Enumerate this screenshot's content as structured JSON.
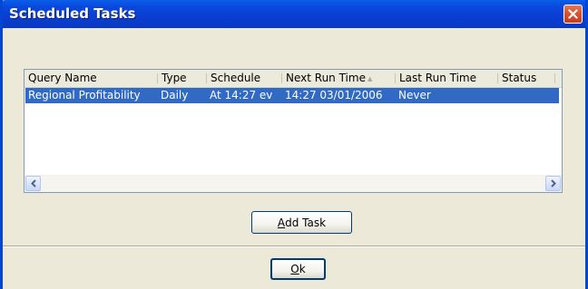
{
  "window": {
    "title": "Scheduled Tasks"
  },
  "table": {
    "columns": [
      "Query Name",
      "Type",
      "Schedule",
      "Next Run Time",
      "Last Run Time",
      "Status"
    ],
    "sorted_column": "Next Run Time",
    "rows": [
      {
        "query_name": "Regional Profitability",
        "type": "Daily",
        "schedule": "At 14:27 ev",
        "next_run_time": "14:27 03/01/2006",
        "last_run_time": "Never",
        "status": ""
      }
    ],
    "selected_row_color": "#316ac5"
  },
  "buttons": {
    "add_task": {
      "mnemonic": "A",
      "rest": "dd Task"
    },
    "ok": {
      "mnemonic": "O",
      "rest": "k"
    }
  },
  "icons": {
    "close": "close-icon",
    "scroll_up": "chevron-up-icon",
    "scroll_down": "chevron-down-icon",
    "scroll_left": "chevron-left-icon",
    "scroll_right": "chevron-right-icon",
    "sort": "sort-ascending-icon"
  },
  "colors": {
    "titlebar": "#0a4be0",
    "close_button": "#d8512d",
    "dialog_background": "#ece9d8"
  }
}
